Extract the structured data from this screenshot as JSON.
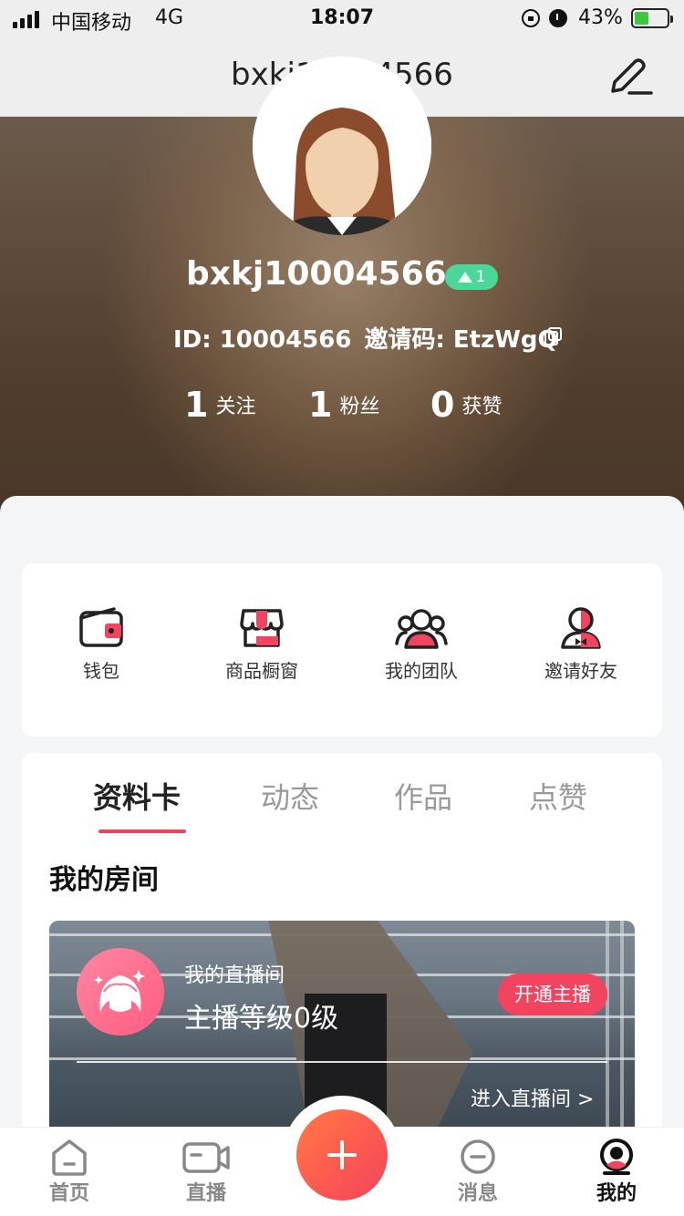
{
  "status_bar": {
    "carrier": "中国移动",
    "network": "4G",
    "time": "18:07",
    "battery": "43%",
    "battery_level": 0.43
  },
  "nav": {
    "title": "bxkj10004566",
    "edit_icon": "edit-pencil-icon"
  },
  "profile": {
    "username": "bxkj10004566",
    "level": "1",
    "id_text": "ID: 10004566",
    "invite_text": "邀请码: EtzWgQ",
    "stats": [
      {
        "value": "1",
        "label": "关注"
      },
      {
        "value": "1",
        "label": "粉丝"
      },
      {
        "value": "0",
        "label": "获赞"
      }
    ]
  },
  "tools": [
    {
      "label": "钱包",
      "icon": "wallet-icon"
    },
    {
      "label": "商品橱窗",
      "icon": "shop-window-icon"
    },
    {
      "label": "我的团队",
      "icon": "team-icon"
    },
    {
      "label": "邀请好友",
      "icon": "invite-friend-icon"
    }
  ],
  "tabs": [
    {
      "label": "资料卡",
      "active": true
    },
    {
      "label": "动态",
      "active": false
    },
    {
      "label": "作品",
      "active": false
    },
    {
      "label": "点赞",
      "active": false
    }
  ],
  "section": {
    "title": "我的房间"
  },
  "room": {
    "subtitle": "我的直播间",
    "level_text": "主播等级0级",
    "open_button": "开通主播",
    "enter_link": "进入直播间 >"
  },
  "tabbar": [
    {
      "label": "首页",
      "icon": "home-icon",
      "active": false
    },
    {
      "label": "直播",
      "icon": "video-camera-icon",
      "active": false
    },
    {
      "label": "消息",
      "icon": "message-icon",
      "active": false
    },
    {
      "label": "我的",
      "icon": "profile-icon",
      "active": true
    }
  ],
  "colors": {
    "accent": "#f2445f",
    "level_badge": "#4cd79a",
    "fab_start": "#ff7a45",
    "fab_end": "#f2445f"
  }
}
